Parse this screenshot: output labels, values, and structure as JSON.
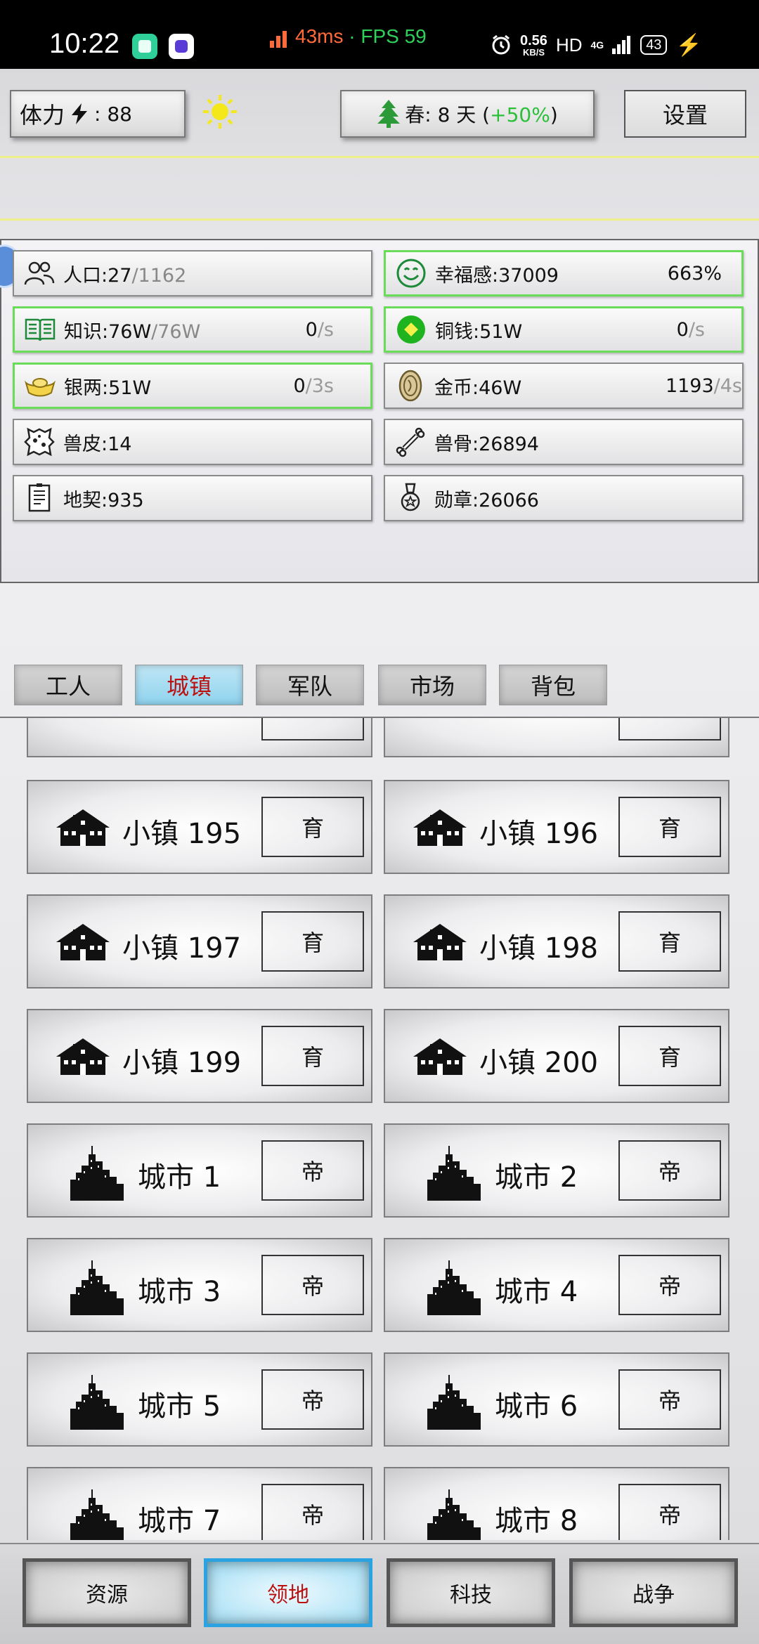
{
  "status_bar": {
    "time": "10:22",
    "latency": "43ms",
    "separator": "·",
    "fps": "FPS 59",
    "net_speed": "0.56",
    "net_unit": "KB/S",
    "hd": "HD",
    "network": "4G",
    "battery": "43"
  },
  "top_bar": {
    "stamina_label": "体力",
    "stamina_value": ": 88",
    "season_text": "春: 8 天 (",
    "season_bonus": "+50%",
    "season_close": ")",
    "settings_label": "设置"
  },
  "resources": {
    "population": {
      "label": "人口:27",
      "of": "/1162"
    },
    "happiness": {
      "label": "幸福感:37009",
      "pct": "663%"
    },
    "knowledge": {
      "label": "知识:76W",
      "of": "/76W",
      "rate": "0",
      "per": "/s"
    },
    "copper": {
      "label": "铜钱:51W",
      "rate": "0",
      "per": "/s"
    },
    "silver": {
      "label": "银两:51W",
      "rate": "0",
      "per": "/3s"
    },
    "gold": {
      "label": "金币:46W",
      "rate": "1193",
      "per": "/4s"
    },
    "hide": {
      "label": "兽皮:14"
    },
    "bone": {
      "label": "兽骨:26894"
    },
    "deed": {
      "label": "地契:935"
    },
    "medal": {
      "label": "勋章:26066"
    }
  },
  "tabs": [
    "工人",
    "城镇",
    "军队",
    "市场",
    "背包"
  ],
  "active_tab": "城镇",
  "towns": [
    {
      "name": "小镇 195",
      "action": "育",
      "kind": "town"
    },
    {
      "name": "小镇 196",
      "action": "育",
      "kind": "town"
    },
    {
      "name": "小镇 197",
      "action": "育",
      "kind": "town"
    },
    {
      "name": "小镇 198",
      "action": "育",
      "kind": "town"
    },
    {
      "name": "小镇 199",
      "action": "育",
      "kind": "town"
    },
    {
      "name": "小镇 200",
      "action": "育",
      "kind": "town"
    },
    {
      "name": "城市 1",
      "action": "帝",
      "kind": "city"
    },
    {
      "name": "城市 2",
      "action": "帝",
      "kind": "city"
    },
    {
      "name": "城市 3",
      "action": "帝",
      "kind": "city"
    },
    {
      "name": "城市 4",
      "action": "帝",
      "kind": "city"
    },
    {
      "name": "城市 5",
      "action": "帝",
      "kind": "city"
    },
    {
      "name": "城市 6",
      "action": "帝",
      "kind": "city"
    },
    {
      "name": "城市 7",
      "action": "帝",
      "kind": "city"
    },
    {
      "name": "城市 8",
      "action": "帝",
      "kind": "city"
    }
  ],
  "bottom_nav": [
    "资源",
    "领地",
    "科技",
    "战争"
  ],
  "active_nav": "领地",
  "colors": {
    "accent_green": "#2bbf3a",
    "active_tab": "#8fd3ee",
    "active_text": "#bb1111",
    "resource_border_green": "#6bdc5a"
  }
}
